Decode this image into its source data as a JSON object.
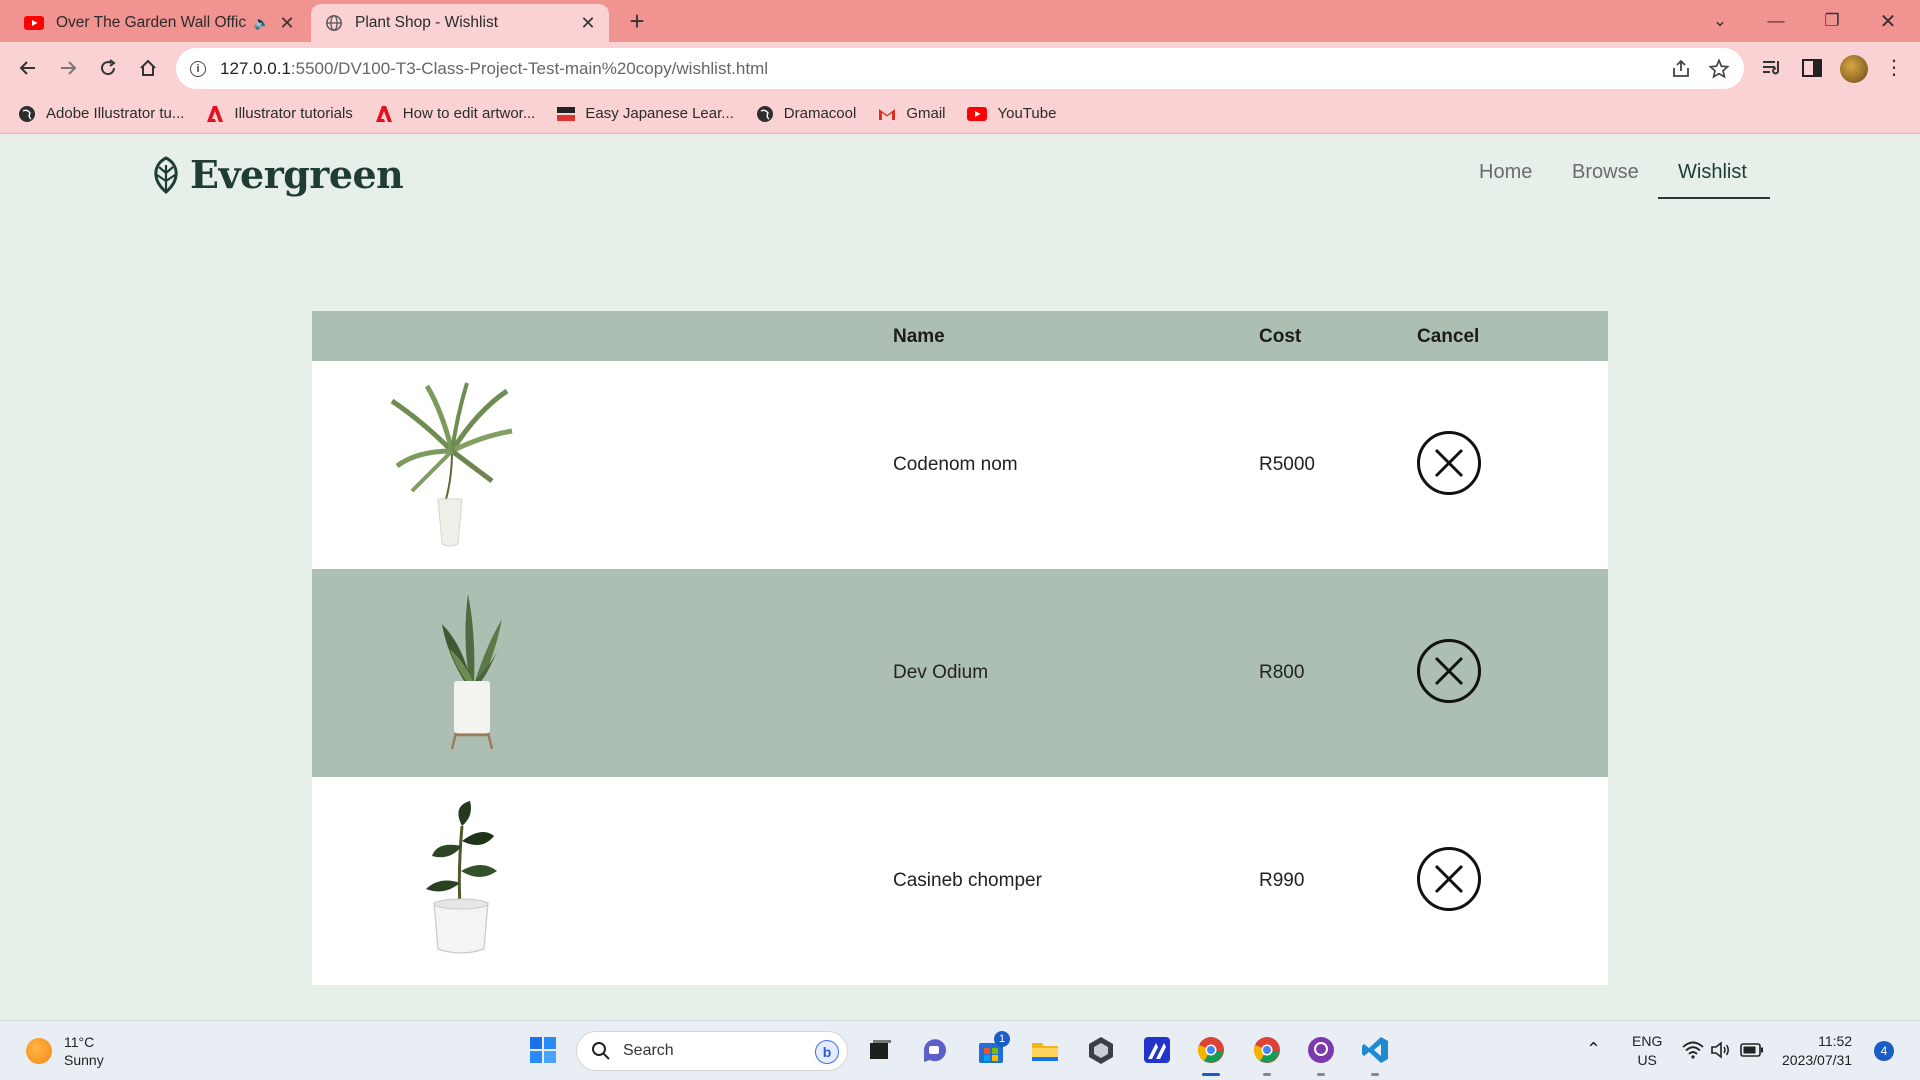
{
  "browser": {
    "tabs": [
      {
        "title": "Over The Garden Wall Official",
        "active": false,
        "audio": "🔈"
      },
      {
        "title": "Plant Shop - Wishlist",
        "active": true
      }
    ],
    "url_host": "127.0.0.1",
    "url_rest": ":5500/DV100-T3-Class-Project-Test-main%20copy/wishlist.html",
    "bookmarks": [
      {
        "label": "Adobe Illustrator tu...",
        "icon": "globe-icon"
      },
      {
        "label": "Illustrator tutorials",
        "icon": "adobe-icon"
      },
      {
        "label": "How to edit artwor...",
        "icon": "adobe-icon"
      },
      {
        "label": "Easy Japanese Lear...",
        "icon": "nhk-icon"
      },
      {
        "label": "Dramacool",
        "icon": "globe-icon"
      },
      {
        "label": "Gmail",
        "icon": "gmail-icon"
      },
      {
        "label": "YouTube",
        "icon": "youtube-icon"
      }
    ]
  },
  "site": {
    "brand": "Evergreen",
    "nav": [
      {
        "label": "Home",
        "active": false
      },
      {
        "label": "Browse",
        "active": false
      },
      {
        "label": "Wishlist",
        "active": true
      }
    ]
  },
  "wishlist": {
    "headers": {
      "name": "Name",
      "cost": "Cost",
      "cancel": "Cancel"
    },
    "items": [
      {
        "name": "Codenom nom",
        "cost": "R5000",
        "plant": "palm"
      },
      {
        "name": "Dev Odium",
        "cost": "R800",
        "plant": "snake-plant"
      },
      {
        "name": "Casineb chomper",
        "cost": "R990",
        "plant": "rubber-plant"
      }
    ]
  },
  "taskbar": {
    "temperature": "11°C",
    "weather": "Sunny",
    "search_placeholder": "Search",
    "store_badge": "1",
    "lang": "ENG",
    "region": "US",
    "time": "11:52",
    "date": "2023/07/31",
    "notifications": "4"
  },
  "colors": {
    "tabbar": "#f19391",
    "chrome": "#fbd2d3",
    "page_bg": "#e6efe8",
    "table_green": "#adbeb2",
    "brand_dark": "#1f3d32"
  }
}
